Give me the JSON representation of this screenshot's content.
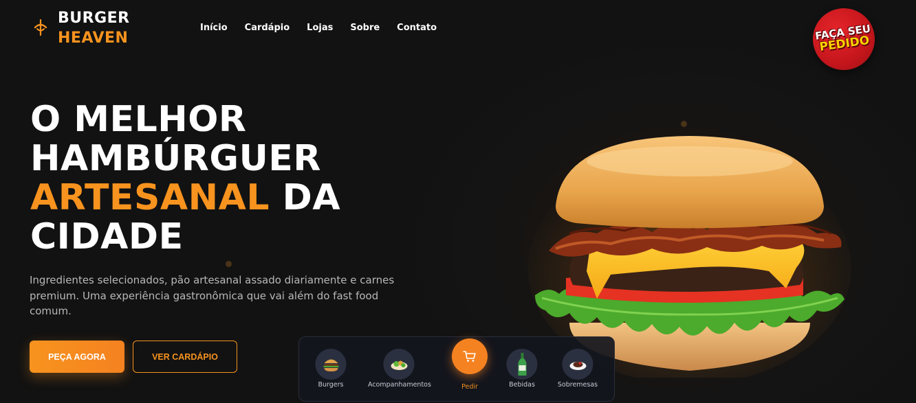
{
  "brand": {
    "line1": "BURGER",
    "line2": "HEAVEN",
    "accent_color": "#f7931e"
  },
  "nav": {
    "items": [
      "Início",
      "Cardápio",
      "Lojas",
      "Sobre",
      "Contato"
    ]
  },
  "badge": {
    "line1": "FAÇA SEU",
    "line2": "PEDIDO",
    "color": "#c4161c"
  },
  "hero": {
    "title_line1": "O MELHOR",
    "title_line2": "HAMBÚRGUER",
    "title_accent": "ARTESANAL",
    "title_line3_rest": " DA",
    "title_line4": "CIDADE",
    "description": "Ingredientes selecionados, pão artesanal assado diariamente e carnes premium. Uma experiência gastronômica que vai além do fast food comum.",
    "primary_button": "PEÇA AGORA",
    "secondary_button": "VER CARDÁPIO"
  },
  "categories": {
    "items": [
      {
        "label": "Burgers",
        "icon": "burger-icon"
      },
      {
        "label": "Acompanhamentos",
        "icon": "salad-icon"
      },
      {
        "label": "Pedir",
        "icon": "cart-icon"
      },
      {
        "label": "Bebidas",
        "icon": "bottle-icon"
      },
      {
        "label": "Sobremesas",
        "icon": "dessert-icon"
      }
    ]
  }
}
